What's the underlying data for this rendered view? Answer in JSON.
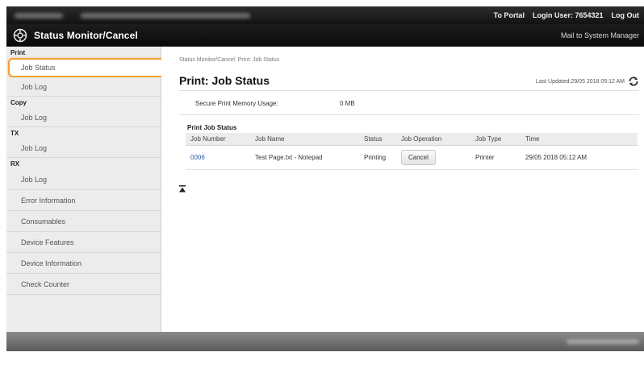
{
  "topbar": {
    "to_portal": "To Portal",
    "login_user": "Login User: 7654321",
    "log_out": "Log Out"
  },
  "header": {
    "app_title": "Status Monitor/Cancel",
    "mail_link": "Mail to System Manager"
  },
  "sidebar": {
    "sections": [
      {
        "title": "Print",
        "items": [
          "Job Status",
          "Job Log"
        ]
      },
      {
        "title": "Copy",
        "items": [
          "Job Log"
        ]
      },
      {
        "title": "TX",
        "items": [
          "Job Log"
        ]
      },
      {
        "title": "RX",
        "items": [
          "Job Log"
        ]
      }
    ],
    "extra_items": [
      "Error Information",
      "Consumables",
      "Device Features",
      "Device Information",
      "Check Counter"
    ],
    "active_item": "Job Status"
  },
  "main": {
    "breadcrumb": "Status Monitor/Cancel: Print: Job Status",
    "title": "Print: Job Status",
    "last_updated": "Last Updated:29/05 2018 05:12 AM",
    "memory_label": "Secure Print Memory Usage:",
    "memory_value": "0 MB",
    "section_title": "Print Job Status",
    "table": {
      "headers": [
        "Job Number",
        "Job Name",
        "Status",
        "Job Operation",
        "Job Type",
        "Time"
      ],
      "rows": [
        {
          "job_number": "0006",
          "job_name": "Test Page.txt - Notepad",
          "status": "Printing",
          "operation": "Cancel",
          "job_type": "Printer",
          "time": "29/05 2018 05:12 AM"
        }
      ]
    }
  },
  "colors": {
    "active_outline": "#f0a030",
    "link": "#2a5caa",
    "header_bg": "#111111"
  },
  "icons": {
    "logo": "status-monitor-logo-icon",
    "refresh": "refresh-icon",
    "to_top": "back-to-top-icon"
  }
}
